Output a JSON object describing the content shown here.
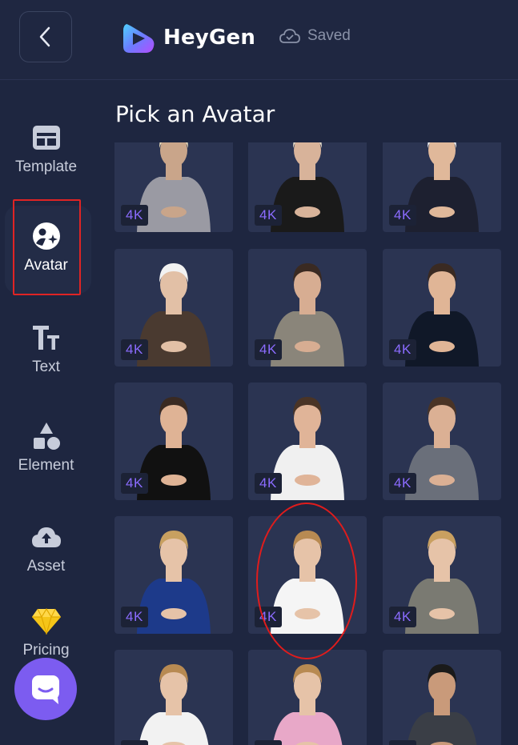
{
  "header": {
    "brand": "HeyGen",
    "saved_label": "Saved"
  },
  "sidebar": {
    "items": [
      {
        "label": "Template",
        "icon": "template-icon"
      },
      {
        "label": "Avatar",
        "icon": "avatar-icon"
      },
      {
        "label": "Text",
        "icon": "text-icon"
      },
      {
        "label": "Element",
        "icon": "element-icon"
      },
      {
        "label": "Asset",
        "icon": "cloud-upload-icon"
      },
      {
        "label": "Pricing",
        "icon": "diamond-icon"
      }
    ],
    "active_index": 1
  },
  "main": {
    "title": "Pick an Avatar",
    "badge": "4K"
  },
  "colors": {
    "background": "#1e2640",
    "card": "#2b3452",
    "accent": "#7c5cf0",
    "badge_text": "#8b6cff",
    "annotation": "#e02424"
  }
}
